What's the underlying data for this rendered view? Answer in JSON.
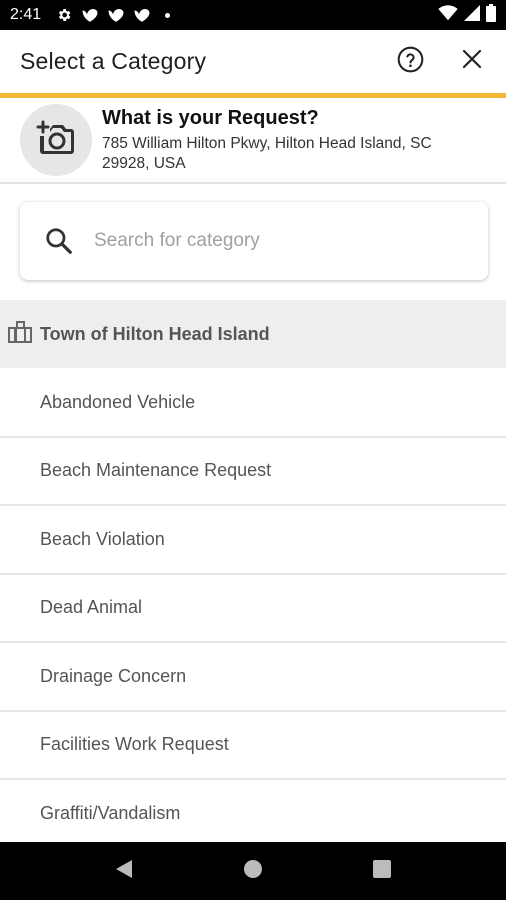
{
  "status_bar": {
    "time": "2:41",
    "left_icons": [
      "gear-icon",
      "notification-icon",
      "notification-icon",
      "notification-icon"
    ],
    "right_icons": [
      "wifi-icon",
      "signal-icon",
      "battery-icon"
    ]
  },
  "app_bar": {
    "title": "Select a Category",
    "help_icon": "help-circle-icon",
    "close_icon": "close-icon",
    "accent_color": "#f2b733"
  },
  "request": {
    "title": "What is your Request?",
    "address": "785 William Hilton Pkwy, Hilton Head Island, SC 29928, USA",
    "photo_icon": "add-photo-icon"
  },
  "search": {
    "placeholder": "Search for category",
    "value": ""
  },
  "section": {
    "title": "Town of Hilton Head Island",
    "icon": "city-icon"
  },
  "categories": [
    {
      "label": "Abandoned Vehicle"
    },
    {
      "label": "Beach Maintenance Request"
    },
    {
      "label": "Beach Violation"
    },
    {
      "label": "Dead Animal"
    },
    {
      "label": "Drainage Concern"
    },
    {
      "label": "Facilities Work Request"
    },
    {
      "label": "Graffiti/Vandalism"
    }
  ],
  "nav_bar": {
    "back_icon": "back-triangle-icon",
    "home_icon": "home-circle-icon",
    "recents_icon": "recents-square-icon"
  }
}
